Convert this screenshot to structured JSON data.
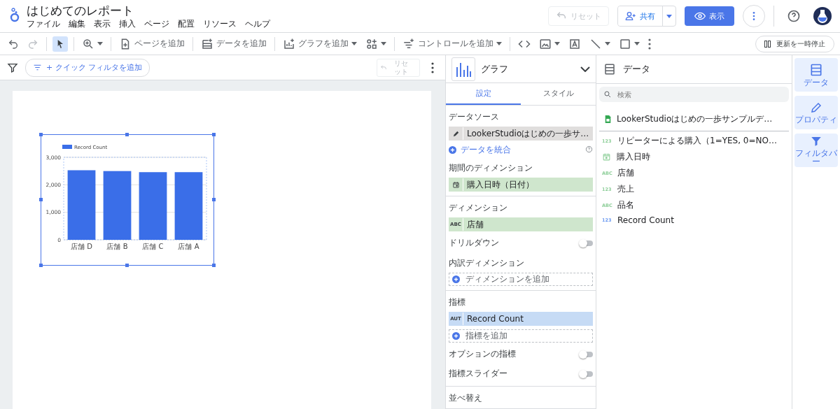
{
  "header": {
    "title": "はじめてのレポート",
    "menu": [
      "ファイル",
      "編集",
      "表示",
      "挿入",
      "ページ",
      "配置",
      "リソース",
      "ヘルプ"
    ],
    "reset": {
      "label": "リセット",
      "disabled": true
    },
    "share": {
      "label": "共有"
    },
    "view": {
      "label": "表示"
    }
  },
  "toolbar": {
    "undo": {
      "disabled": false
    },
    "redo": {
      "disabled": true
    },
    "pointer": {
      "selected": true
    },
    "items": [
      {
        "kind": "separator"
      },
      {
        "kind": "zoom",
        "dropdown": true
      },
      {
        "kind": "separator"
      },
      {
        "kind": "page",
        "label": "ページを追加"
      },
      {
        "kind": "separator"
      },
      {
        "kind": "data",
        "label": "データを追加"
      },
      {
        "kind": "separator"
      },
      {
        "kind": "chart",
        "label": "グラフを追加",
        "dropdown": true
      },
      {
        "kind": "community",
        "dropdown": true
      },
      {
        "kind": "separator"
      },
      {
        "kind": "control",
        "label": "コントロールを追加",
        "dropdown": true
      },
      {
        "kind": "separator"
      },
      {
        "kind": "code"
      },
      {
        "kind": "image",
        "dropdown": true
      },
      {
        "kind": "text"
      },
      {
        "kind": "line",
        "dropdown": true
      },
      {
        "kind": "shape",
        "dropdown": true
      },
      {
        "kind": "more"
      }
    ],
    "pause": {
      "label": "更新を一時停止"
    }
  },
  "filter_bar": {
    "quick_filter": "+ クイック フィルタを追加",
    "reset": {
      "label": "リセット",
      "disabled": true
    }
  },
  "chart": {
    "chart_data": {
      "type": "bar",
      "categories": [
        "店舗 D",
        "店舗 B",
        "店舗 C",
        "店舗 A"
      ],
      "series": [
        {
          "name": "Record Count",
          "color": "#3a6ee8",
          "values": [
            2530,
            2500,
            2460,
            2460
          ]
        }
      ],
      "ylim": [
        0,
        3000
      ],
      "yticks": [
        {
          "value": 0,
          "label": "0"
        },
        {
          "value": 1000,
          "label": "1,000"
        },
        {
          "value": 2000,
          "label": "2,000"
        },
        {
          "value": 3000,
          "label": "3,000"
        }
      ]
    }
  },
  "properties": {
    "chart_type": "グラフ",
    "expanded": false,
    "tabs": [
      {
        "label": "設定",
        "selected": true
      },
      {
        "label": "スタイル",
        "selected": false
      }
    ],
    "sections": [
      {
        "rows": [
          {
            "kind": "heading",
            "label": "データソース"
          },
          {
            "kind": "source-chip",
            "label": "LookerStudioはじめの一歩サ…"
          },
          {
            "kind": "link",
            "label": "データを統合"
          },
          {
            "kind": "heading",
            "label": "期間のディメンション"
          },
          {
            "kind": "date-chip",
            "label": "購入日時（日付）"
          }
        ]
      },
      {
        "rows": [
          {
            "kind": "heading",
            "label": "ディメンション"
          },
          {
            "kind": "dimension-chip",
            "tag": "ABC",
            "label": "店舗"
          },
          {
            "kind": "toggle",
            "label": "ドリルダウン",
            "on": false
          },
          {
            "kind": "heading",
            "label": "内訳ディメンション"
          },
          {
            "kind": "add",
            "label": "ディメンションを追加"
          }
        ]
      },
      {
        "rows": [
          {
            "kind": "heading",
            "label": "指標"
          },
          {
            "kind": "metric-chip",
            "tag": "AUT",
            "label": "Record Count"
          },
          {
            "kind": "add",
            "label": "指標を追加"
          },
          {
            "kind": "toggle",
            "label": "オプションの指標",
            "on": false
          },
          {
            "kind": "toggle",
            "label": "指標スライダー",
            "on": false
          }
        ]
      },
      {
        "rows": [
          {
            "kind": "heading",
            "label": "並べ替え"
          }
        ]
      }
    ]
  },
  "data_panel": {
    "title": "データ",
    "search_placeholder": "検索",
    "source": "LookerStudioはじめの一歩サンプルデ…",
    "fields": [
      {
        "kind": "dimension-tag",
        "tag": "123",
        "label": "リピーターによる購入（1=YES, 0=NO…"
      },
      {
        "kind": "dimension-date",
        "label": "購入日時"
      },
      {
        "kind": "dimension-tag",
        "tag": "ABC",
        "label": "店舗"
      },
      {
        "kind": "dimension-tag",
        "tag": "123",
        "label": "売上"
      },
      {
        "kind": "dimension-tag",
        "tag": "ABC",
        "label": "品名"
      },
      {
        "kind": "metric-tag",
        "tag": "123",
        "label": "Record Count"
      }
    ]
  },
  "rail": [
    {
      "kind": "data",
      "label": "データ"
    },
    {
      "kind": "properties",
      "label": "プロパティ"
    },
    {
      "kind": "filter",
      "label": "フィルタバー"
    }
  ]
}
